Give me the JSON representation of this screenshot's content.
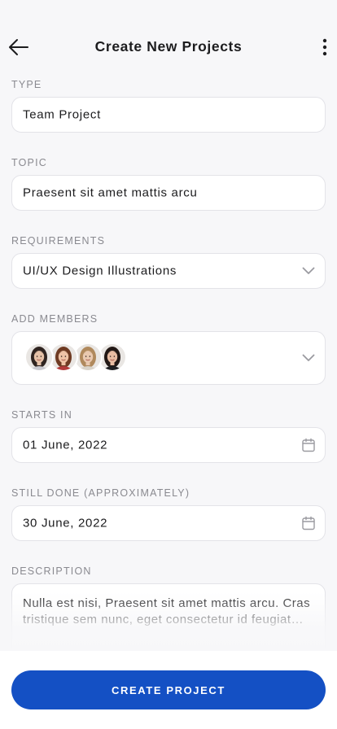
{
  "header": {
    "title": "Create New Projects",
    "back_icon": "arrow-left-icon",
    "more_icon": "more-vertical-icon"
  },
  "type": {
    "label": "TYPE",
    "value": "Team Project"
  },
  "topic": {
    "label": "TOPIC",
    "value": "Praesent sit amet mattis arcu"
  },
  "requirements": {
    "label": "REQUIREMENTS",
    "value": "UI/UX Design Illustrations",
    "icon": "chevron-down-icon"
  },
  "members": {
    "label": "ADD MEMBERS",
    "icon": "chevron-down-icon",
    "avatars": [
      {
        "skin": "#e6c2a8",
        "hair": "#2f2420",
        "shirt": "#c9c9cf"
      },
      {
        "skin": "#efc3a6",
        "hair": "#6e3a22",
        "shirt": "#b33a3a"
      },
      {
        "skin": "#e9c9b0",
        "hair": "#b0895c",
        "shirt": "#d9d3c9"
      },
      {
        "skin": "#e8bda3",
        "hair": "#221815",
        "shirt": "#1f1f22"
      }
    ]
  },
  "starts_in": {
    "label": "STARTS IN",
    "value": "01 June, 2022",
    "icon": "calendar-icon"
  },
  "still_done": {
    "label": "STILL DONE (APPROXIMATELY)",
    "value": "30 June, 2022",
    "icon": "calendar-icon"
  },
  "description": {
    "label": "DESCRIPTION",
    "value": "Nulla est nisi,  Praesent sit amet mattis arcu. Cras tristique sem nunc, eget consectetur id feugiat…"
  },
  "footer": {
    "create_label": "CREATE PROJECT"
  },
  "colors": {
    "accent": "#1450c4",
    "background": "#f7f7f9",
    "label": "#8a8a90",
    "border": "#e3e3e8"
  }
}
